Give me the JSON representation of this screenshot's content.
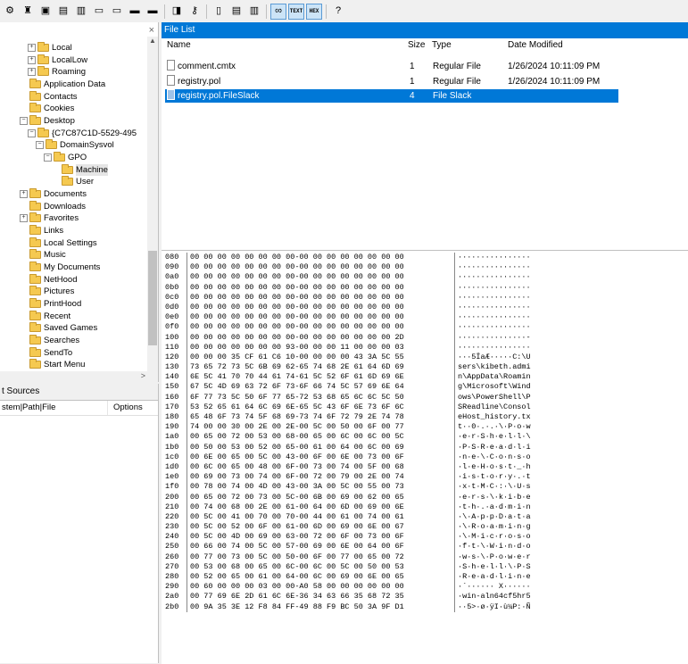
{
  "toolbar": {
    "buttons": [
      {
        "name": "capture-icon",
        "glyph": "⚙"
      },
      {
        "name": "evidence-icon",
        "glyph": "♜"
      },
      {
        "name": "mount-icon",
        "glyph": "▣"
      },
      {
        "name": "save-icon",
        "glyph": "▤"
      },
      {
        "name": "export-icon",
        "glyph": "▥"
      },
      {
        "name": "drive-icon",
        "glyph": "▭"
      },
      {
        "name": "network-icon",
        "glyph": "▭"
      },
      {
        "name": "disk-icon",
        "glyph": "▬"
      },
      {
        "name": "memory-icon",
        "glyph": "▬"
      },
      {
        "name": "hash-icon",
        "glyph": "◨"
      },
      {
        "name": "key-icon",
        "glyph": "⚷"
      },
      {
        "name": "page-icon",
        "glyph": "▯"
      },
      {
        "name": "doc-icon",
        "glyph": "▤"
      },
      {
        "name": "text-icon",
        "glyph": "▥"
      },
      {
        "name": "view-icon",
        "glyph": "∞"
      },
      {
        "name": "text-view-icon",
        "glyph": "TEXT"
      },
      {
        "name": "hex-view-icon",
        "glyph": "HEX"
      },
      {
        "name": "help-icon",
        "glyph": "?"
      }
    ]
  },
  "tree": {
    "close": "×",
    "nodes": [
      {
        "label": "Local",
        "indent": 3,
        "exp": "+"
      },
      {
        "label": "LocalLow",
        "indent": 3,
        "exp": "+"
      },
      {
        "label": "Roaming",
        "indent": 3,
        "exp": "+"
      },
      {
        "label": "Application Data",
        "indent": 2,
        "exp": ""
      },
      {
        "label": "Contacts",
        "indent": 2,
        "exp": ""
      },
      {
        "label": "Cookies",
        "indent": 2,
        "exp": ""
      },
      {
        "label": "Desktop",
        "indent": 2,
        "exp": "−"
      },
      {
        "label": "{C7C87C1D-5529-495",
        "indent": 3,
        "exp": "−"
      },
      {
        "label": "DomainSysvol",
        "indent": 4,
        "exp": "−"
      },
      {
        "label": "GPO",
        "indent": 5,
        "exp": "−"
      },
      {
        "label": "Machine",
        "indent": 6,
        "exp": "",
        "sel": true
      },
      {
        "label": "User",
        "indent": 6,
        "exp": ""
      },
      {
        "label": "Documents",
        "indent": 2,
        "exp": "+"
      },
      {
        "label": "Downloads",
        "indent": 2,
        "exp": ""
      },
      {
        "label": "Favorites",
        "indent": 2,
        "exp": "+"
      },
      {
        "label": "Links",
        "indent": 2,
        "exp": ""
      },
      {
        "label": "Local Settings",
        "indent": 2,
        "exp": ""
      },
      {
        "label": "Music",
        "indent": 2,
        "exp": ""
      },
      {
        "label": "My Documents",
        "indent": 2,
        "exp": ""
      },
      {
        "label": "NetHood",
        "indent": 2,
        "exp": ""
      },
      {
        "label": "Pictures",
        "indent": 2,
        "exp": ""
      },
      {
        "label": "PrintHood",
        "indent": 2,
        "exp": ""
      },
      {
        "label": "Recent",
        "indent": 2,
        "exp": ""
      },
      {
        "label": "Saved Games",
        "indent": 2,
        "exp": ""
      },
      {
        "label": "Searches",
        "indent": 2,
        "exp": ""
      },
      {
        "label": "SendTo",
        "indent": 2,
        "exp": ""
      },
      {
        "label": "Start Menu",
        "indent": 2,
        "exp": ""
      }
    ]
  },
  "sources": {
    "title": "t Sources",
    "col1": "stem|Path|File",
    "col2": "Options"
  },
  "file_list": {
    "title": "File List",
    "columns": {
      "name": "Name",
      "size": "Size",
      "type": "Type",
      "date": "Date Modified"
    },
    "rows": [
      {
        "name": "comment.cmtx",
        "size": "1",
        "type": "Regular File",
        "date": "1/26/2024 10:11:09 PM",
        "sel": false
      },
      {
        "name": "registry.pol",
        "size": "1",
        "type": "Regular File",
        "date": "1/26/2024 10:11:09 PM",
        "sel": false
      },
      {
        "name": "registry.pol.FileSlack",
        "size": "4",
        "type": "File Slack",
        "date": "",
        "sel": true
      }
    ]
  },
  "hex": [
    {
      "off": "080",
      "bytes": "00 00 00 00 00 00 00 00-00 00 00 00 00 00 00 00",
      "ascii": "················"
    },
    {
      "off": "090",
      "bytes": "00 00 00 00 00 00 00 00-00 00 00 00 00 00 00 00",
      "ascii": "················"
    },
    {
      "off": "0a0",
      "bytes": "00 00 00 00 00 00 00 00-00 00 00 00 00 00 00 00",
      "ascii": "················"
    },
    {
      "off": "0b0",
      "bytes": "00 00 00 00 00 00 00 00-00 00 00 00 00 00 00 00",
      "ascii": "················"
    },
    {
      "off": "0c0",
      "bytes": "00 00 00 00 00 00 00 00-00 00 00 00 00 00 00 00",
      "ascii": "················"
    },
    {
      "off": "0d0",
      "bytes": "00 00 00 00 00 00 00 00-00 00 00 00 00 00 00 00",
      "ascii": "················"
    },
    {
      "off": "0e0",
      "bytes": "00 00 00 00 00 00 00 00-00 00 00 00 00 00 00 00",
      "ascii": "················"
    },
    {
      "off": "0f0",
      "bytes": "00 00 00 00 00 00 00 00-00 00 00 00 00 00 00 00",
      "ascii": "················"
    },
    {
      "off": "100",
      "bytes": "00 00 00 00 00 00 00 00-00 00 00 00 00 00 00 2D",
      "ascii": "···············-"
    },
    {
      "off": "110",
      "bytes": "00 00 00 00 00 00 00 93-00 00 00 11 00 00 00 03",
      "ascii": "················"
    },
    {
      "off": "120",
      "bytes": "00 00 00 35 CF 61 C6 10-00 00 00 00 43 3A 5C 55",
      "ascii": "···5ÏaÆ·····C:\\U"
    },
    {
      "off": "130",
      "bytes": "73 65 72 73 5C 6B 69 62-65 74 68 2E 61 64 6D 69",
      "ascii": "sers\\kibeth.admi"
    },
    {
      "off": "140",
      "bytes": "6E 5C 41 70 70 44 61 74-61 5C 52 6F 61 6D 69 6E",
      "ascii": "n\\AppData\\Roamin"
    },
    {
      "off": "150",
      "bytes": "67 5C 4D 69 63 72 6F 73-6F 66 74 5C 57 69 6E 64",
      "ascii": "g\\Microsoft\\Wind"
    },
    {
      "off": "160",
      "bytes": "6F 77 73 5C 50 6F 77 65-72 53 68 65 6C 6C 5C 50",
      "ascii": "ows\\PowerShell\\P"
    },
    {
      "off": "170",
      "bytes": "53 52 65 61 64 6C 69 6E-65 5C 43 6F 6E 73 6F 6C",
      "ascii": "SReadline\\Consol"
    },
    {
      "off": "180",
      "bytes": "65 48 6F 73 74 5F 68 69-73 74 6F 72 79 2E 74 78",
      "ascii": "eHost_history.tx"
    },
    {
      "off": "190",
      "bytes": "74 00 00 30 00 2E 00 2E-00 5C 00 50 00 6F 00 77",
      "ascii": "t··0·.·.·\\·P·o·w"
    },
    {
      "off": "1a0",
      "bytes": "00 65 00 72 00 53 00 68-00 65 00 6C 00 6C 00 5C",
      "ascii": "·e·r·S·h·e·l·l·\\"
    },
    {
      "off": "1b0",
      "bytes": "00 50 00 53 00 52 00 65-00 61 00 64 00 6C 00 69",
      "ascii": "·P·S·R·e·a·d·l·i"
    },
    {
      "off": "1c0",
      "bytes": "00 6E 00 65 00 5C 00 43-00 6F 00 6E 00 73 00 6F",
      "ascii": "·n·e·\\·C·o·n·s·o"
    },
    {
      "off": "1d0",
      "bytes": "00 6C 00 65 00 48 00 6F-00 73 00 74 00 5F 00 68",
      "ascii": "·l·e·H·o·s·t·_·h"
    },
    {
      "off": "1e0",
      "bytes": "00 69 00 73 00 74 00 6F-00 72 00 79 00 2E 00 74",
      "ascii": "·i·s·t·o·r·y·.·t"
    },
    {
      "off": "1f0",
      "bytes": "00 78 00 74 00 4D 00 43-00 3A 00 5C 00 55 00 73",
      "ascii": "·x·t·M·C·:·\\·U·s"
    },
    {
      "off": "200",
      "bytes": "00 65 00 72 00 73 00 5C-00 6B 00 69 00 62 00 65",
      "ascii": "·e·r·s·\\·k·i·b·e"
    },
    {
      "off": "210",
      "bytes": "00 74 00 68 00 2E 00 61-00 64 00 6D 00 69 00 6E",
      "ascii": "·t·h·.·a·d·m·i·n"
    },
    {
      "off": "220",
      "bytes": "00 5C 00 41 00 70 00 70-00 44 00 61 00 74 00 61",
      "ascii": "·\\·A·p·p·D·a·t·a"
    },
    {
      "off": "230",
      "bytes": "00 5C 00 52 00 6F 00 61-00 6D 00 69 00 6E 00 67",
      "ascii": "·\\·R·o·a·m·i·n·g"
    },
    {
      "off": "240",
      "bytes": "00 5C 00 4D 00 69 00 63-00 72 00 6F 00 73 00 6F",
      "ascii": "·\\·M·i·c·r·o·s·o"
    },
    {
      "off": "250",
      "bytes": "00 66 00 74 00 5C 00 57-00 69 00 6E 00 64 00 6F",
      "ascii": "·f·t·\\·W·i·n·d·o"
    },
    {
      "off": "260",
      "bytes": "00 77 00 73 00 5C 00 50-00 6F 00 77 00 65 00 72",
      "ascii": "·w·s·\\·P·o·w·e·r"
    },
    {
      "off": "270",
      "bytes": "00 53 00 68 00 65 00 6C-00 6C 00 5C 00 50 00 53",
      "ascii": "·S·h·e·l·l·\\·P·S"
    },
    {
      "off": "280",
      "bytes": "00 52 00 65 00 61 00 64-00 6C 00 69 00 6E 00 65",
      "ascii": "·R·e·a·d·l·i·n·e"
    },
    {
      "off": "290",
      "bytes": "00 60 00 00 00 03 00 00-A0 58 00 00 00 00 00 00",
      "ascii": "·`······ X······"
    },
    {
      "off": "2a0",
      "bytes": "00 77 69 6E 2D 61 6C 6E-36 34 63 66 35 68 72 35",
      "ascii": "·win-aln64cf5hr5"
    },
    {
      "off": "2b0",
      "bytes": "00 9A 35 3E 12 F8 84 FF-49 88 F9 BC 50 3A 9F D1",
      "ascii": "··5>·ø·ÿI·ù¼P:·Ñ"
    }
  ]
}
